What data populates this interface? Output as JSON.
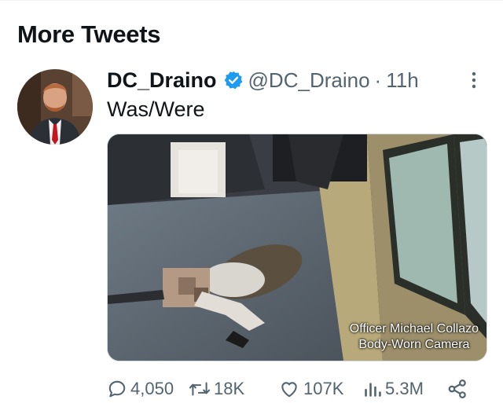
{
  "section": {
    "title": "More Tweets"
  },
  "tweet": {
    "display_name": "DC_Draino",
    "handle": "@DC_Draino",
    "separator": "·",
    "time": "11h",
    "text": "Was/Were",
    "verified_color": "#1d9bf0",
    "media": {
      "overlay_line1": "Officer Michael Collazo",
      "overlay_line2": "Body-Worn Camera"
    },
    "stats": {
      "replies": "4,050",
      "retweets": "18K",
      "likes": "107K",
      "views": "5.3M"
    }
  }
}
